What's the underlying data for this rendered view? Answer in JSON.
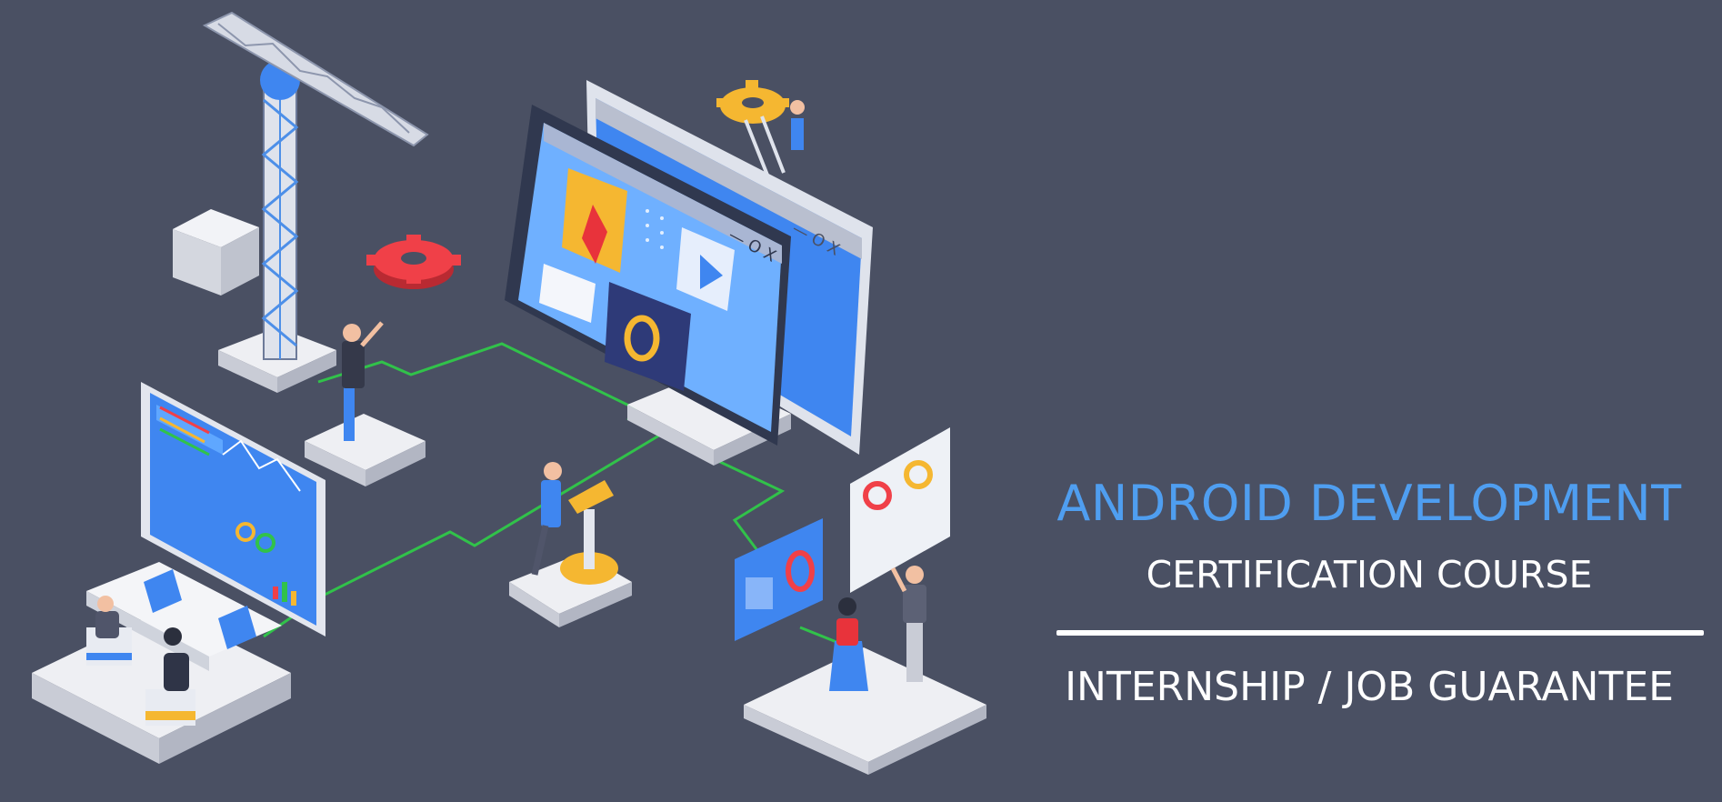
{
  "banner": {
    "headline": "ANDROID DEVELOPMENT",
    "subheadline": "CERTIFICATION COURSE",
    "tagline": "INTERNSHIP / JOB GUARANTEE"
  },
  "illustration": {
    "subject": "isometric software development scene",
    "icons": [
      "crane-icon",
      "gear-icon",
      "monitor-icon",
      "play-icon",
      "pen-tool-icon",
      "chart-icon",
      "pie-chart-icon",
      "laptop-icon",
      "people-icon"
    ]
  },
  "colors": {
    "background": "#4a5063",
    "headline": "#4f9ef0",
    "text": "#ffffff",
    "screen_blue": "#3f86f0",
    "screen_light": "#6fb0ff",
    "platform": "#eeeff3",
    "platform_side": "#c9ccd6",
    "gear_yellow": "#f5b731",
    "gear_red": "#e8333b",
    "circuit_green": "#31c24a",
    "frame_gray": "#d9dce3"
  }
}
